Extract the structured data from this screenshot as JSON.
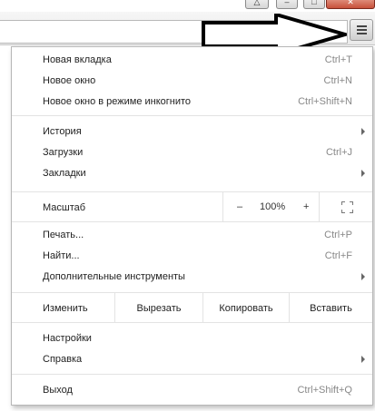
{
  "menu": {
    "section1": [
      {
        "label": "Новая вкладка",
        "shortcut": "Ctrl+T"
      },
      {
        "label": "Новое окно",
        "shortcut": "Ctrl+N"
      },
      {
        "label": "Новое окно в режиме инкогнито",
        "shortcut": "Ctrl+Shift+N"
      }
    ],
    "section2": [
      {
        "label": "История",
        "shortcut": ""
      },
      {
        "label": "Загрузки",
        "shortcut": "Ctrl+J"
      },
      {
        "label": "Закладки",
        "shortcut": ""
      }
    ],
    "zoom": {
      "label": "Масштаб",
      "minus": "–",
      "value": "100%",
      "plus": "+"
    },
    "section3": [
      {
        "label": "Печать...",
        "shortcut": "Ctrl+P"
      },
      {
        "label": "Найти...",
        "shortcut": "Ctrl+F"
      },
      {
        "label": "Дополнительные инструменты",
        "shortcut": ""
      }
    ],
    "edit": {
      "label": "Изменить",
      "cut": "Вырезать",
      "copy": "Копировать",
      "paste": "Вставить"
    },
    "section4": [
      {
        "label": "Настройки",
        "shortcut": ""
      },
      {
        "label": "Справка",
        "shortcut": ""
      }
    ],
    "exit": {
      "label": "Выход",
      "shortcut": "Ctrl+Shift+Q"
    }
  },
  "icons": {
    "menu_button": "hamburger-menu-icon",
    "star": "bookmark-star-icon",
    "arrow": "annotation-arrow-icon",
    "fullscreen": "fullscreen-icon"
  },
  "colors": {
    "menu_border": "#b7b7b7",
    "shortcut_text": "#888888",
    "close_button": "#c7503a"
  }
}
